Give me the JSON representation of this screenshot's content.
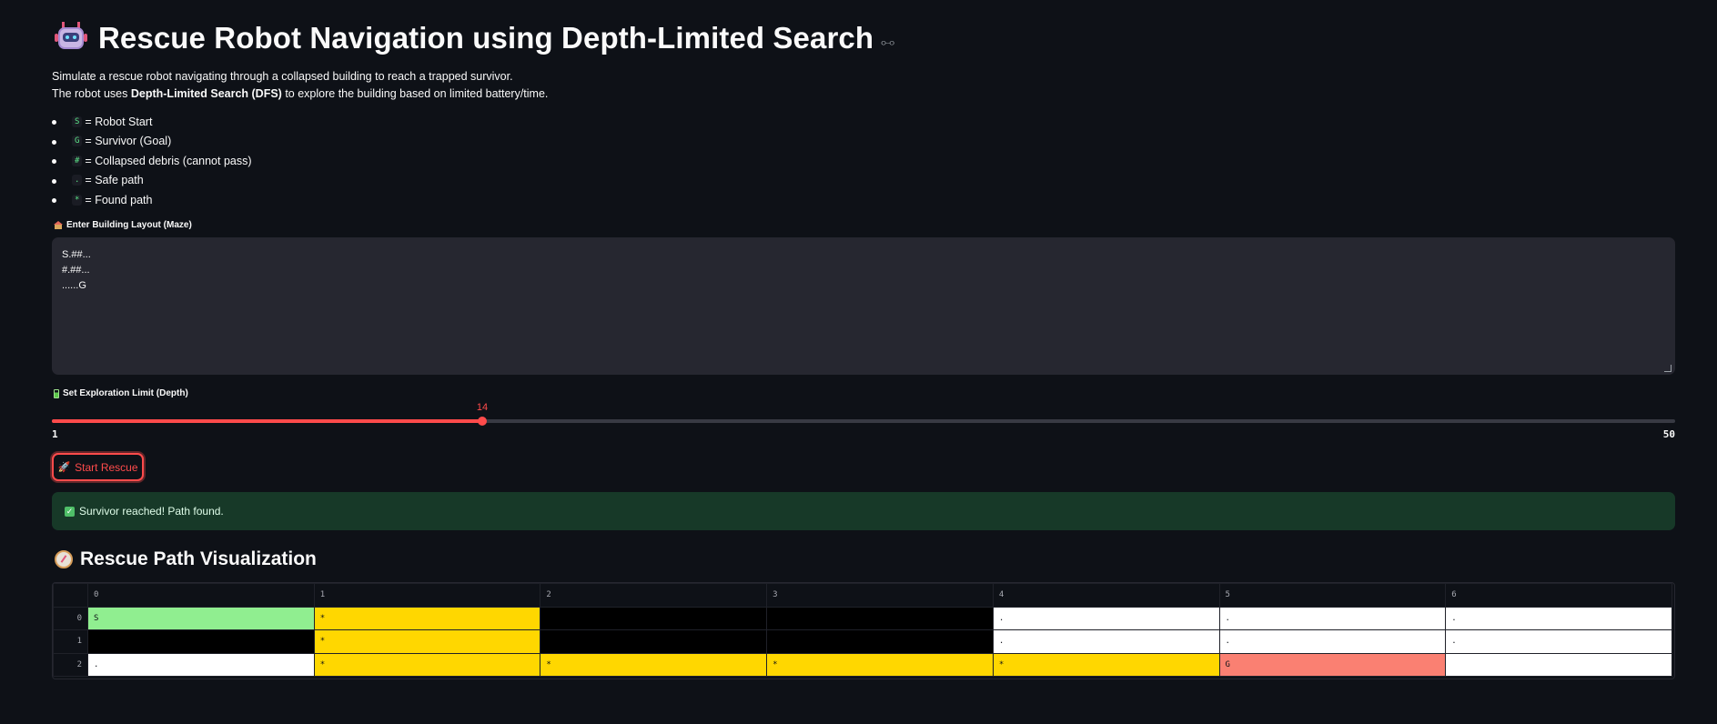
{
  "header": {
    "icon": "robot-icon",
    "title": "Rescue Robot Navigation using Depth-Limited Search",
    "link_icon": "link-icon"
  },
  "description": {
    "line1": "Simulate a rescue robot navigating through a collapsed building to reach a trapped survivor.",
    "line2_prefix": "The robot uses ",
    "line2_bold": "Depth-Limited Search (DFS)",
    "line2_suffix": " to explore the building based on limited battery/time."
  },
  "legend": [
    {
      "code": "S",
      "text": "= Robot Start"
    },
    {
      "code": "G",
      "text": "= Survivor (Goal)"
    },
    {
      "code": "#",
      "text": "= Collapsed debris (cannot pass)"
    },
    {
      "code": ".",
      "text": "= Safe path"
    },
    {
      "code": "*",
      "text": "= Found path"
    }
  ],
  "maze_input": {
    "label": "Enter Building Layout (Maze)",
    "label_icon": "house-icon",
    "value": "S.##...\n#.##...\n......G"
  },
  "depth_slider": {
    "label": "Set Exploration Limit (Depth)",
    "label_icon": "battery-icon",
    "min": "1",
    "max": "50",
    "value": "14",
    "fraction": 0.265
  },
  "start_button": {
    "label": "Start Rescue",
    "icon": "rocket-icon"
  },
  "status": {
    "icon": "check-icon",
    "message": "Survivor reached! Path found."
  },
  "visualization": {
    "title": "Rescue Path Visualization",
    "icon": "compass-icon",
    "columns": [
      "0",
      "1",
      "2",
      "3",
      "4",
      "5",
      "6"
    ],
    "rows": [
      {
        "index": "0",
        "cells": [
          "S",
          "*",
          "",
          "",
          ".",
          ".",
          "."
        ]
      },
      {
        "index": "1",
        "cells": [
          "",
          "*",
          "",
          "",
          ".",
          ".",
          "."
        ]
      },
      {
        "index": "2",
        "cells": [
          ".",
          "*",
          "*",
          "*",
          "*",
          "G",
          ""
        ]
      }
    ],
    "cell_colors": {
      "S": "#90ee90",
      "*": "#ffd700",
      "#": "#000000",
      ".": "#ffffff",
      "G": "#fa8072"
    },
    "cell_types": [
      [
        "S",
        "*",
        "#",
        "#",
        ".",
        ".",
        "."
      ],
      [
        "#",
        "*",
        "#",
        "#",
        ".",
        ".",
        "."
      ],
      [
        ".",
        "*",
        "*",
        "*",
        "*",
        "G",
        "."
      ]
    ]
  },
  "colors": {
    "background": "#0e1117",
    "accent": "#ff4b4b",
    "success_bg": "#173928"
  }
}
